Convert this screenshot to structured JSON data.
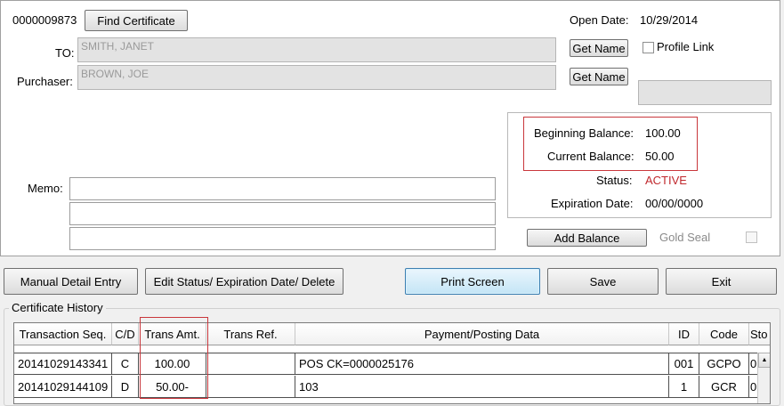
{
  "certificate": {
    "number": "0000009873",
    "find_button": "Find Certificate"
  },
  "open_date": {
    "label": "Open Date:",
    "value": "10/29/2014"
  },
  "to": {
    "label": "TO:",
    "value": "SMITH, JANET",
    "get_name": "Get Name"
  },
  "purchaser": {
    "label": "Purchaser:",
    "value": "BROWN, JOE",
    "get_name": "Get Name"
  },
  "profile_link": {
    "label": "Profile Link",
    "checked": false
  },
  "balances": {
    "beginning_label": "Beginning Balance:",
    "beginning_value": "100.00",
    "current_label": "Current Balance:",
    "current_value": "50.00",
    "status_label": "Status:",
    "status_value": "ACTIVE",
    "expiration_label": "Expiration Date:",
    "expiration_value": "00/00/0000"
  },
  "memo": {
    "label": "Memo:"
  },
  "add_balance": "Add Balance",
  "gold_seal": {
    "label": "Gold Seal",
    "checked": false
  },
  "toolbar": {
    "manual_detail": "Manual Detail Entry",
    "edit_status": "Edit Status/ Expiration Date/ Delete",
    "print_screen": "Print Screen",
    "save": "Save",
    "exit": "Exit"
  },
  "history": {
    "title": "Certificate History",
    "columns": [
      "Transaction Seq.",
      "C/D",
      "Trans Amt.",
      "Trans Ref.",
      "Payment/Posting Data",
      "ID",
      "Code",
      "Sto"
    ],
    "rows": [
      [
        "20141029143341",
        "C",
        "100.00",
        "",
        "POS CK=0000025176",
        "001",
        "GCPO",
        "0"
      ],
      [
        "20141029144109",
        "D",
        "50.00-",
        "",
        "103",
        "1",
        "GCR",
        "0"
      ]
    ]
  },
  "colors": {
    "status_active": "#c0282d",
    "highlight_box": "#c9373c",
    "focus_button": "#3c7fb1"
  }
}
